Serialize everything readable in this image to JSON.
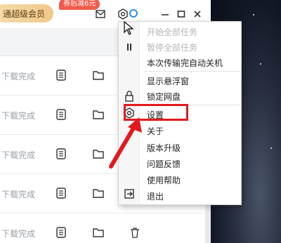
{
  "titlebar": {
    "vip_label": "通超级会员",
    "promo_badge": "券后减6元"
  },
  "rows": [
    {
      "status": "下载完成"
    },
    {
      "status": "下载完成"
    },
    {
      "status": "下载完成"
    },
    {
      "status": "下载完成"
    },
    {
      "status": "下载完成"
    }
  ],
  "menu": {
    "items": [
      {
        "label": "开始全部任务",
        "disabled": true
      },
      {
        "label": "暂停全部任务",
        "disabled": true
      },
      {
        "label": "本次传输完自动关机",
        "disabled": false
      },
      {
        "label": "显示悬浮窗",
        "disabled": false
      },
      {
        "label": "锁定网盘",
        "disabled": false
      },
      {
        "label": "设置",
        "disabled": false
      },
      {
        "label": "关于",
        "disabled": false
      },
      {
        "label": "版本升级",
        "disabled": false
      },
      {
        "label": "问题反馈",
        "disabled": false
      },
      {
        "label": "使用帮助",
        "disabled": false
      },
      {
        "label": "退出",
        "disabled": false
      }
    ]
  },
  "colors": {
    "highlight": "#e2191d",
    "vip_gold": "#f0c889",
    "badge_red": "#f25a4b"
  }
}
